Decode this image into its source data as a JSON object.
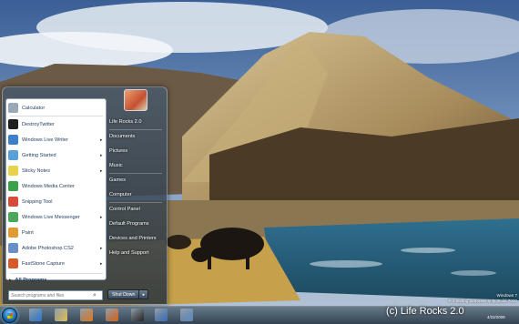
{
  "start_menu": {
    "programs": [
      {
        "label": "Calculator",
        "arrow": false,
        "icon": "calculator-icon",
        "color": "#9aa8b8"
      },
      {
        "label": "DestroyTwitter",
        "arrow": false,
        "icon": "destroytwitter-icon",
        "color": "#1f1f1f"
      },
      {
        "label": "Windows Live Writer",
        "arrow": true,
        "icon": "live-writer-icon",
        "color": "#3d7fc8"
      },
      {
        "label": "Getting Started",
        "arrow": true,
        "icon": "getting-started-icon",
        "color": "#5aa0d8"
      },
      {
        "label": "Sticky Notes",
        "arrow": true,
        "icon": "sticky-notes-icon",
        "color": "#e8d24a"
      },
      {
        "label": "Windows Media Center",
        "arrow": false,
        "icon": "media-center-icon",
        "color": "#3aa04a"
      },
      {
        "label": "Snipping Tool",
        "arrow": false,
        "icon": "snipping-tool-icon",
        "color": "#d84a3a"
      },
      {
        "label": "Windows Live Messenger",
        "arrow": true,
        "icon": "messenger-icon",
        "color": "#4aa85a"
      },
      {
        "label": "Paint",
        "arrow": false,
        "icon": "paint-icon",
        "color": "#e09a30"
      },
      {
        "label": "Adobe Photoshop CS2",
        "arrow": true,
        "icon": "photoshop-icon",
        "color": "#6a8ec8"
      },
      {
        "label": "FastStone Capture",
        "arrow": true,
        "icon": "faststone-icon",
        "color": "#d85a2a"
      }
    ],
    "all_programs": "All Programs",
    "search_placeholder": "Search programs and files",
    "places": [
      "Life Rocks 2.0",
      "Documents",
      "Pictures",
      "Music",
      "Games",
      "Computer",
      "Control Panel",
      "Default Programs",
      "Devices and Printers",
      "Help and Support"
    ],
    "shutdown_label": "Shut Down",
    "shutdown_arrow": "▸"
  },
  "taskbar": {
    "icons": [
      {
        "name": "ie-icon",
        "color": "#2a7ad0"
      },
      {
        "name": "explorer-icon",
        "color": "#e3c25a"
      },
      {
        "name": "media-player-icon",
        "color": "#e07a20"
      },
      {
        "name": "firefox-icon",
        "color": "#d8641a"
      },
      {
        "name": "destroytwitter-icon",
        "color": "#262626"
      },
      {
        "name": "live-writer-icon",
        "color": "#3a6fb8"
      },
      {
        "name": "paint-icon",
        "color": "#5a8ac0"
      }
    ],
    "watermark_line1": "Windows 7",
    "watermark_line2": "For testing purposes only. Build 7000",
    "copyright": "(c) Life Rocks 2.0",
    "date": "4/22/2009"
  }
}
